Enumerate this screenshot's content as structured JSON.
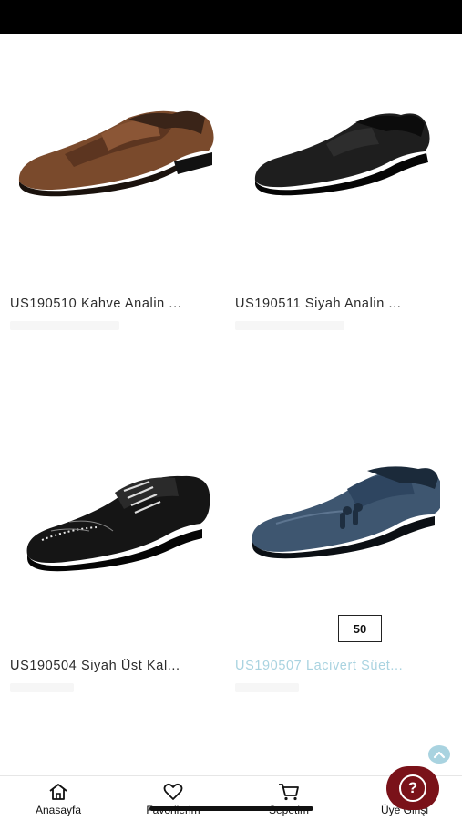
{
  "products": [
    {
      "title": "US190510 Kahve Analin ...",
      "image_icon": "brown-woven-loafer-image",
      "title_color": "#2b2b2b"
    },
    {
      "title": "US190511 Siyah Analin ...",
      "image_icon": "black-penny-loafer-image",
      "title_color": "#2b2b2b"
    },
    {
      "title": "US190504 Siyah Üst Kal...",
      "image_icon": "black-patent-brogue-image",
      "title_color": "#2b2b2b"
    },
    {
      "title": "US190507 Lacivert Süet...",
      "image_icon": "navy-suede-tassel-loafer-image",
      "title_color": "#a9d3e0",
      "badge": "50"
    }
  ],
  "tabbar": {
    "home": "Anasayfa",
    "favorites": "Favorilerim",
    "cart": "Sepetim",
    "login": "Üye Girişi"
  },
  "help": {
    "glyph": "?"
  },
  "colors": {
    "accent": "#7a1219",
    "scroll_top": "#a9d3e0"
  }
}
